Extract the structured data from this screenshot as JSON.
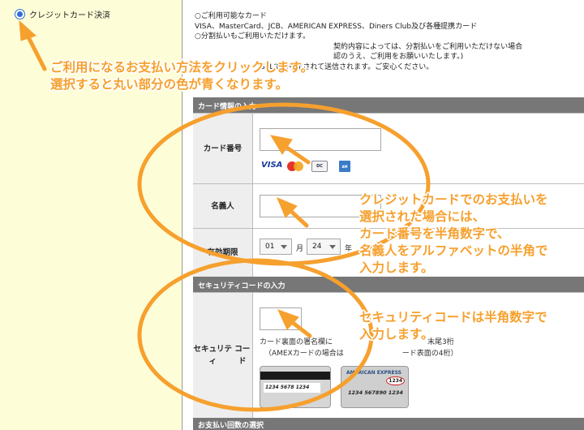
{
  "payment_method": {
    "label": "クレジットカード決済",
    "selected": true
  },
  "info_lines": [
    "○ご利用可能なカード",
    "VISA、MasterCard、JCB、AMERICAN EXPRESS、Diners Club及び各種提携カード",
    "○分割払いもご利用いただけます。",
    "　　　　　　　　　　　　　　　　　　　契約内容によっては、分割払いをご利用いただけない場合",
    "　　　　　　　　　　　　　　　　　　　認のうえ、ご利用をお願いいたします。)",
    "　　　　　　　　　SSLで暗号化されて送信されます。ご安心ください。"
  ],
  "card_info_section": {
    "title": "カード情報の入力",
    "card_number_label": "カード番号",
    "cardholder_label": "名義人",
    "expiry_label": "有効期限",
    "expiry_month": "01",
    "expiry_month_unit": "月",
    "expiry_year": "24",
    "expiry_year_unit": "年",
    "brands": [
      "VISA",
      "MasterCard",
      "Diners Club",
      "AMERICAN EXPRESS"
    ]
  },
  "security_section": {
    "title": "セキュリティコードの入力",
    "label_line1": "セキュリティ",
    "label_line2": "コード",
    "help_line1": "カード裏面の署名欄に　　　　　　　　　　　　　末尾3桁",
    "help_line2": "（AMEXカードの場合は　　　　　　　　ード表面の4桁）",
    "card_back_number": "1234 5678 1234",
    "card_front_title": "AMERICAN EXPRESS",
    "card_front_number": "1234 567890 1234",
    "card_front_code": "1234"
  },
  "installment_section": {
    "title": "お支払い回数の選択"
  },
  "annotations": {
    "tip1_line1": "ご利用になるお支払い方法をクリックします。",
    "tip1_line2": "選択すると丸い部分の色が青くなります。",
    "tip2_line1": "クレジットカードでのお支払いを",
    "tip2_line2": "選択された場合には、",
    "tip2_line3": "カード番号を半角数字で、",
    "tip2_line4": "名義人をアルファベットの半角で",
    "tip2_line5": "入力します。",
    "tip3_line1": "セキュリティコードは半角数字で",
    "tip3_line2": "入力します。"
  },
  "colors": {
    "left_bg": "#fdfdd7",
    "accent_orange": "#f6a02e",
    "radio_blue": "#2f6fd6",
    "section_header": "#777777"
  }
}
